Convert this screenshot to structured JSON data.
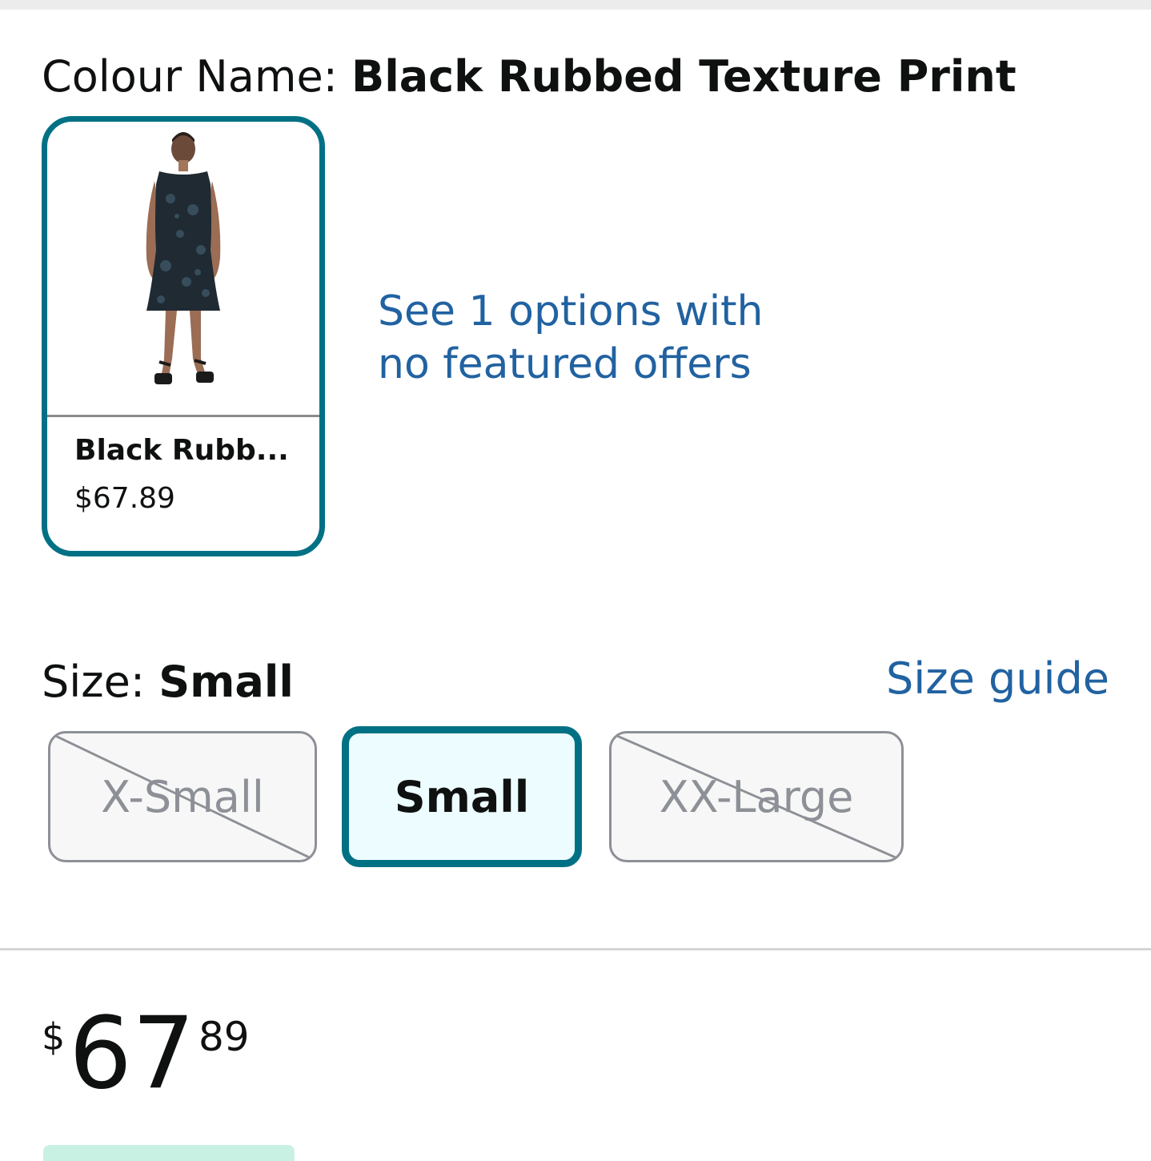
{
  "colour": {
    "label": "Colour Name: ",
    "value": "Black Rubbed Texture Print"
  },
  "swatch": {
    "name": "Black Rubb...",
    "price": "$67.89",
    "image_icon": "dress-product-photo",
    "selected": true
  },
  "options_link": {
    "line1": "See 1 options with",
    "line2": "no featured offers"
  },
  "size": {
    "label": "Size: ",
    "value": "Small",
    "guide_label": "Size guide",
    "options": [
      {
        "label": "X-Small",
        "available": false,
        "selected": false
      },
      {
        "label": "Small",
        "available": true,
        "selected": true
      },
      {
        "label": "XX-Large",
        "available": false,
        "selected": false
      }
    ]
  },
  "price": {
    "symbol": "$",
    "whole": "67",
    "fraction": "89"
  },
  "colors": {
    "accent": "#007185",
    "link": "#2162a1",
    "selected_bg": "#edfdff",
    "unavailable": "#8d9096"
  }
}
